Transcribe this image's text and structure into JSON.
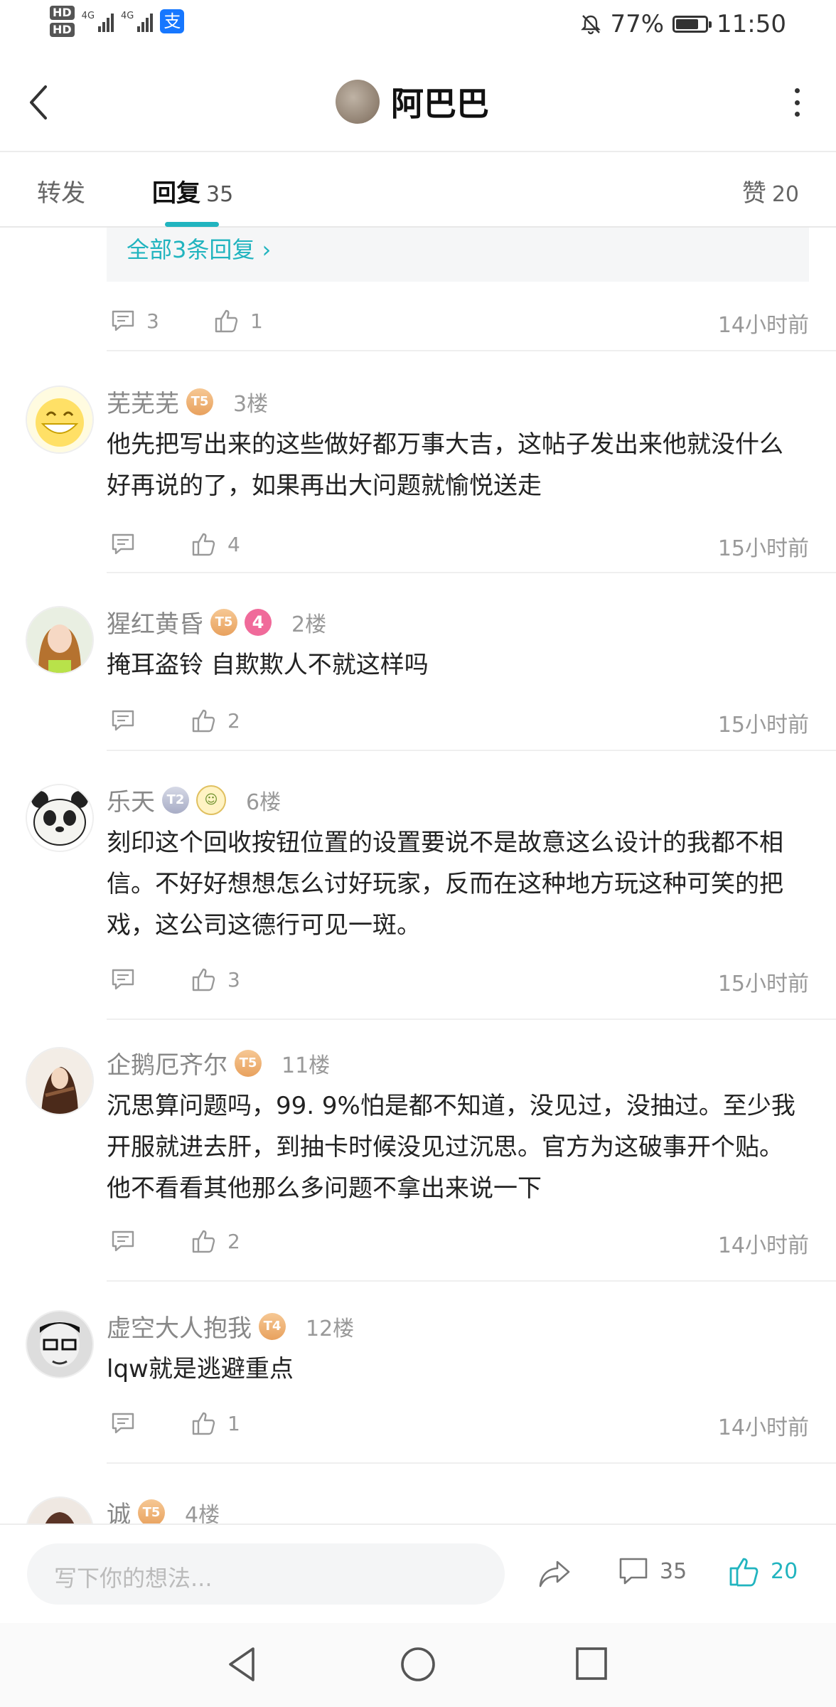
{
  "status": {
    "battery": "77%",
    "battery_level": 0.77,
    "time": "11:50",
    "hd1": "HD",
    "hd2": "HD",
    "net1": "4G",
    "net2": "4G",
    "alipay": "支"
  },
  "nav": {
    "title": "阿巴巴"
  },
  "tabs": {
    "repost": "转发",
    "reply": "回复",
    "reply_count": "35",
    "like": "赞",
    "like_count": "20"
  },
  "top_stub": {
    "all_replies": "全部3条回复",
    "comments": "3",
    "likes": "1",
    "time": "14小时前"
  },
  "posts": [
    {
      "name": "芜芜芜",
      "badges": [
        "T5"
      ],
      "floor": "3楼",
      "text": "他先把写出来的这些做好都万事大吉，这帖子发出来他就没什么好再说的了，如果再出大问题就愉悦送走",
      "likes": "4",
      "time": "15小时前"
    },
    {
      "name": "猩红黄昏",
      "badges": [
        "T5",
        "4"
      ],
      "floor": "2楼",
      "text": "掩耳盗铃 自欺欺人不就这样吗",
      "likes": "2",
      "time": "15小时前"
    },
    {
      "name": "乐天",
      "badges": [
        "T2"
      ],
      "floor": "6楼",
      "text": "刻印这个回收按钮位置的设置要说不是故意这么设计的我都不相信。不好好想想怎么讨好玩家，反而在这种地方玩这种可笑的把戏，这公司这德行可见一斑。",
      "likes": "3",
      "time": "15小时前"
    },
    {
      "name": "企鹅厄齐尔",
      "badges": [
        "T5"
      ],
      "floor": "11楼",
      "text": "沉思算问题吗，99. 9%怕是都不知道，没见过，没抽过。至少我开服就进去肝，到抽卡时候没见过沉思。官方为这破事开个贴。他不看看其他那么多问题不拿出来说一下",
      "likes": "2",
      "time": "14小时前"
    },
    {
      "name": "虚空大人抱我",
      "badges": [
        "T4"
      ],
      "floor": "12楼",
      "text": "lqw就是逃避重点",
      "likes": "1",
      "time": "14小时前"
    },
    {
      "name": "诚",
      "badges": [
        "T5"
      ],
      "floor": "4楼"
    }
  ],
  "bottom": {
    "placeholder": "写下你的想法...",
    "comments": "35",
    "likes": "20"
  },
  "colors": {
    "accent": "#21b4bf"
  }
}
